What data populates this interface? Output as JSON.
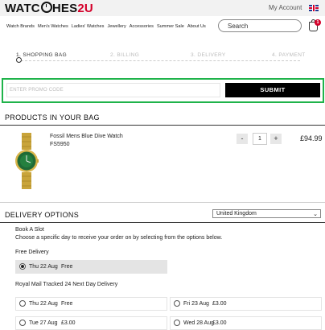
{
  "header": {
    "logo_prefix": "WATC",
    "logo_mid": "HES",
    "logo_suffix": "2U",
    "my_account": "My Account",
    "flag_icon": "uk-flag-icon",
    "bag_count": "1",
    "search_label": "Search"
  },
  "nav": [
    "Watch Brands",
    "Men's Watches",
    "Ladies' Watches",
    "Jewellery",
    "Accessories",
    "Summer Sale",
    "About Us"
  ],
  "steps": [
    "1. SHOPPING BAG",
    "2. BILLING",
    "3. DELIVERY",
    "4. PAYMENT"
  ],
  "promo": {
    "placeholder": "ENTER PROMO CODE",
    "submit": "SUBMIT"
  },
  "bag": {
    "title": "PRODUCTS IN YOUR BAG",
    "item": {
      "name": "Fossil Mens Blue Dive Watch",
      "code": "FS5950",
      "quantity": "1",
      "minus": "-",
      "plus": "+",
      "price": "£94.99"
    }
  },
  "delivery": {
    "title": "DELIVERY OPTIONS",
    "country": "United Kingdom",
    "book_slot": "Book A Slot",
    "instruction": "Choose a specific day to receive your order on by selecting from the options below.",
    "free_heading": "Free Delivery",
    "free_slot": {
      "date": "Thu 22 Aug",
      "price": "Free"
    },
    "tracked_heading": "Royal Mail Tracked 24 Next Day Delivery",
    "tracked_slots": [
      {
        "date": "Thu 22 Aug",
        "price": "Free"
      },
      {
        "date": "Fri 23 Aug",
        "price": "£3.00"
      },
      {
        "date": "Tue 27 Aug",
        "price": "£3.00"
      },
      {
        "date": "Wed 28 Aug",
        "price": "£3.00"
      }
    ]
  },
  "colors": {
    "accent": "#d4002a",
    "promo_border": "#1fb34a",
    "button": "#000000",
    "selected_slot": "#e4e4e4"
  }
}
